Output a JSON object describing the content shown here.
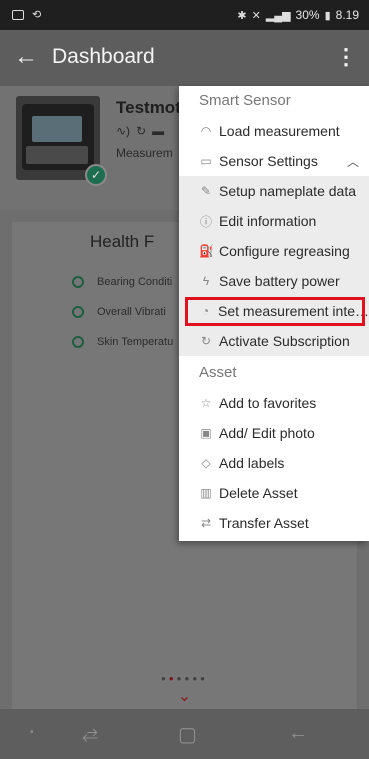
{
  "status_bar": {
    "right_text": "30%",
    "time": "8.19"
  },
  "app_bar": {
    "back_icon": "arrow-left-icon",
    "title": "Dashboard",
    "menu_icon": "more-vert-icon"
  },
  "asset": {
    "name": "Testmot",
    "measurement_label": "Measurem",
    "status_icon": "check-icon"
  },
  "health": {
    "title": "Health F",
    "items": [
      {
        "label": "Bearing Conditi"
      },
      {
        "label": "Overall Vibrati"
      },
      {
        "label": "Skin Temperatu"
      }
    ]
  },
  "menu": {
    "section_smart_sensor": "Smart Sensor",
    "load_measurement": "Load measurement",
    "sensor_settings": "Sensor Settings",
    "sensor_sub": [
      {
        "label": "Setup nameplate data",
        "icon": "edit-icon"
      },
      {
        "label": "Edit information",
        "icon": "info-icon"
      },
      {
        "label": "Configure regreasing",
        "icon": "grease-icon"
      },
      {
        "label": "Save battery power",
        "icon": "bolt-icon"
      },
      {
        "label": "Set measurement inte…",
        "icon": "timer-icon"
      },
      {
        "label": "Activate Subscription",
        "icon": "refresh-icon"
      }
    ],
    "section_asset": "Asset",
    "asset_items": [
      {
        "label": "Add to favorites",
        "icon": "star-icon"
      },
      {
        "label": "Add/ Edit photo",
        "icon": "photo-icon"
      },
      {
        "label": "Add labels",
        "icon": "label-icon"
      },
      {
        "label": "Delete Asset",
        "icon": "trash-icon"
      },
      {
        "label": "Transfer Asset",
        "icon": "transfer-icon"
      }
    ]
  },
  "colors": {
    "highlight": "#e0101e",
    "accent": "#1d6e50",
    "pager_active": "#7a1515"
  }
}
